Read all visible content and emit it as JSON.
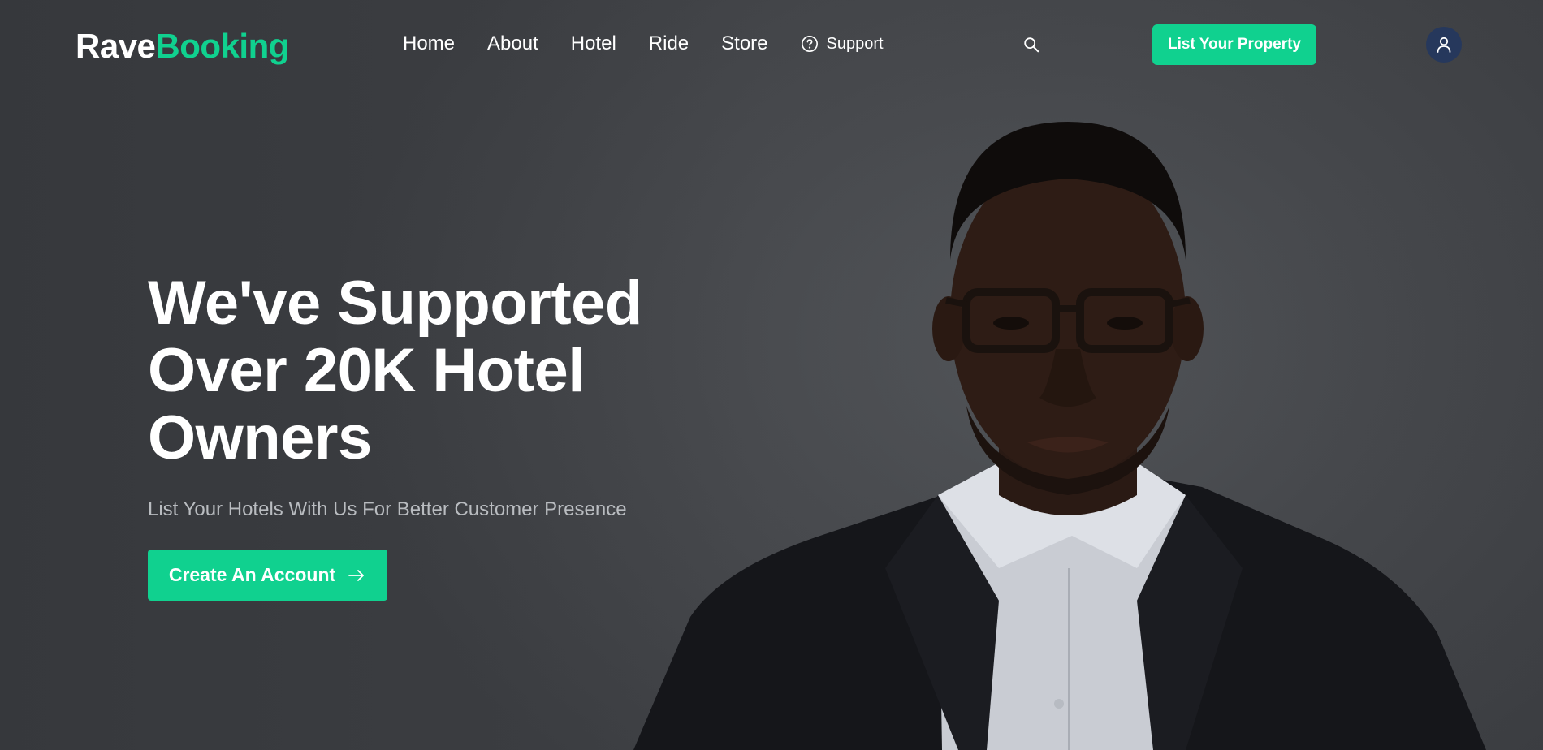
{
  "brand": {
    "part1": "Rave",
    "part2": "Booking",
    "accent_color": "#10d18f"
  },
  "nav": {
    "links": [
      "Home",
      "About",
      "Hotel",
      "Ride",
      "Store"
    ],
    "support_label": "Support",
    "support_icon": "question-circle-icon",
    "search_icon": "search-icon"
  },
  "header": {
    "list_property_label": "List Your Property",
    "avatar_icon": "user-icon"
  },
  "hero": {
    "title_line1": "We've Supported",
    "title_line2": "Over 20K Hotel",
    "title_line3": "Owners",
    "subtitle": "List Your Hotels With Us For Better Customer Presence",
    "cta_label": "Create An Account",
    "cta_icon": "arrow-right-icon"
  }
}
